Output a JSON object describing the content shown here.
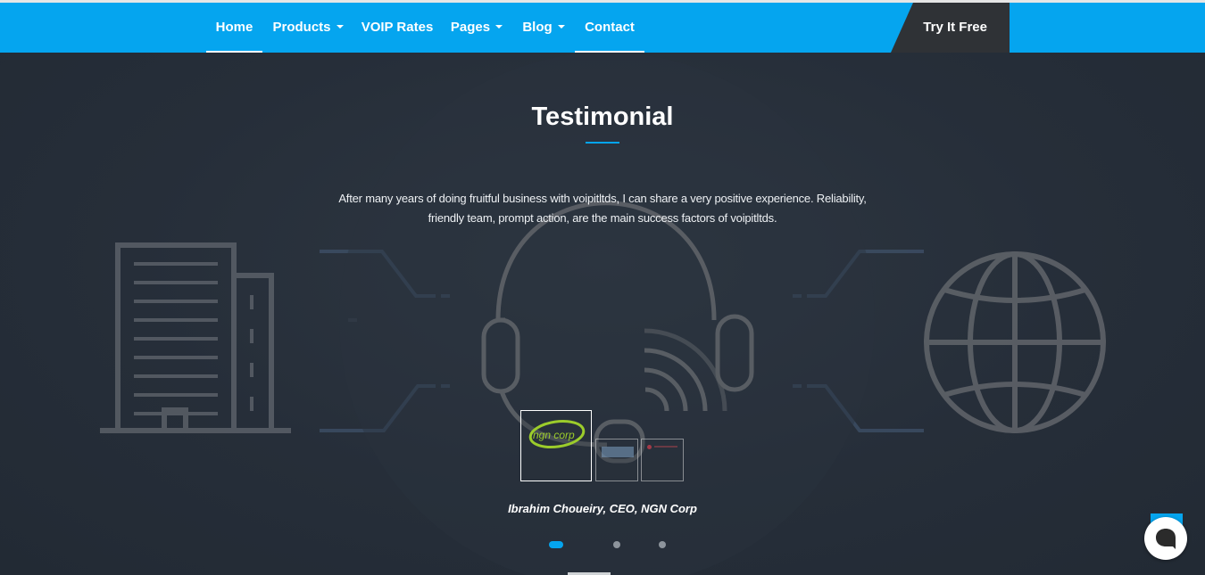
{
  "nav": {
    "items": [
      {
        "label": "Home",
        "dropdown": false,
        "active": true
      },
      {
        "label": "Products",
        "dropdown": true,
        "active": false
      },
      {
        "label": "VOIP Rates",
        "dropdown": false,
        "active": false
      },
      {
        "label": "Pages",
        "dropdown": true,
        "active": false
      },
      {
        "label": "Blog",
        "dropdown": true,
        "active": false
      },
      {
        "label": "Contact",
        "dropdown": false,
        "active": true
      }
    ],
    "cta_label": "Try It Free"
  },
  "testimonial": {
    "title": "Testimonial",
    "quote": "After many years of doing fruitful business with voipitltds, I can share a very positive experience. Reliability, friendly team, prompt action, are the main success factors of voipitltds.",
    "author": "Ibrahim Choueiry, CEO, NGN Corp",
    "logos": [
      {
        "text": "ngn corp",
        "active": true
      },
      {
        "text": "",
        "active": false
      },
      {
        "text": "",
        "active": false
      }
    ],
    "dots_count": 3,
    "active_dot": 0
  },
  "colors": {
    "accent": "#05a5ef",
    "hero_bg": "#262e39",
    "cta_bg": "#2f3236",
    "art_stroke": "#5a6068"
  },
  "icons": [
    "building-icon",
    "headset-icon",
    "globe-icon",
    "chat-icon"
  ]
}
